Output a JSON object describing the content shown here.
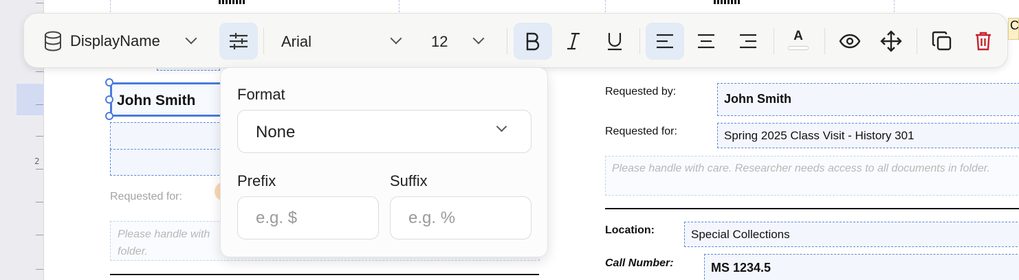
{
  "ruler": {
    "marker": "2"
  },
  "toolbar": {
    "field_name": "DisplayName",
    "font_family": "Arial",
    "font_size": "12",
    "text_color_glyph": "A",
    "icons": [
      "database-icon",
      "sliders-icon",
      "bold-icon",
      "italic-icon",
      "underline-icon",
      "align-left-icon",
      "align-center-icon",
      "align-right-icon",
      "text-color-icon",
      "eye-icon",
      "move-icon",
      "duplicate-icon",
      "delete-icon"
    ],
    "colors": {
      "active_bg": "#e2ebf6",
      "delete": "#c8232c"
    }
  },
  "popover": {
    "format_label": "Format",
    "format_value": "None",
    "prefix_label": "Prefix",
    "prefix_placeholder": "e.g. $",
    "suffix_label": "Suffix",
    "suffix_placeholder": "e.g. %"
  },
  "document": {
    "selected_field_value": "John Smith",
    "left_requested_for_label": "Requested for:",
    "left_note": "Please handle with",
    "left_note_line2": "folder.",
    "requested_by_label": "Requested by:",
    "requested_by_value": "John Smith",
    "requested_for_label": "Requested for:",
    "requested_for_value": "Spring 2025 Class Visit - History 301",
    "note_placeholder": "Please handle with care. Researcher needs access to all documents in folder.",
    "location_label": "Location:",
    "location_value": "Special Collections",
    "call_number_label": "Call Number:",
    "call_number_value": "MS 1234.5",
    "right_edge_tag": "C"
  },
  "colors": {
    "selection": "#4a7bdc",
    "field_border": "#5b86de"
  }
}
